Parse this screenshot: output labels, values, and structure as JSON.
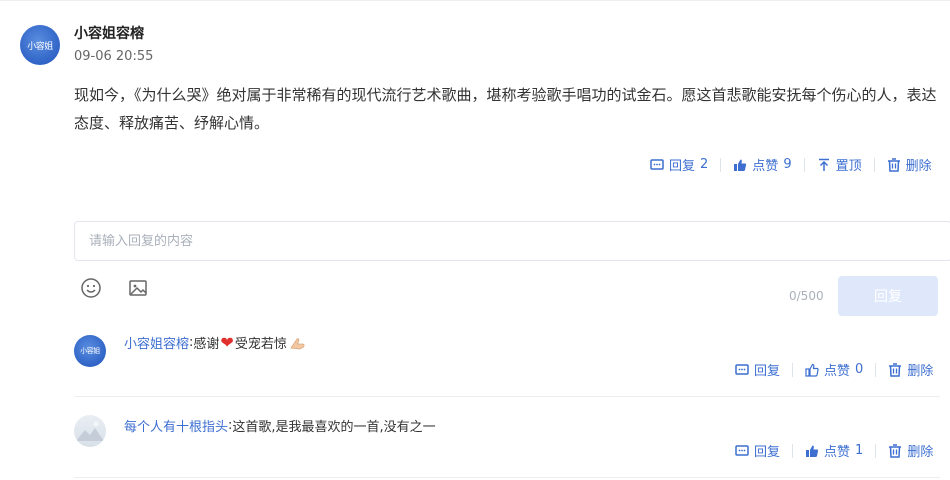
{
  "main_comment": {
    "avatar_text": "小容姐",
    "author": "小容姐容榕",
    "date": "09-06 20:55",
    "content": "现如今，《为什么哭》绝对属于非常稀有的现代流行艺术歌曲，堪称考验歌手唱功的试金石。愿这首悲歌能安抚每个伤心的人，表达态度、释放痛苦、纾解心情。",
    "actions": {
      "reply_label": "回复",
      "reply_count": "2",
      "like_label": "点赞",
      "like_count": "9",
      "pin_label": "置顶",
      "delete_label": "删除"
    }
  },
  "reply_box": {
    "placeholder": "请输入回复的内容",
    "counter": "0/500",
    "submit_label": "回复"
  },
  "replies": [
    {
      "avatar_text": "小容姐",
      "author": "小容姐容榕",
      "colon": ":",
      "text_before": "感谢",
      "emoji_heart": "❤",
      "text_after": "受宠若惊",
      "actions": {
        "reply_label": "回复",
        "like_label": "点赞",
        "like_count": "0",
        "delete_label": "删除"
      }
    },
    {
      "author": "每个人有十根指头",
      "colon": ":",
      "text": "这首歌,是我最喜欢的一首,没有之一",
      "actions": {
        "reply_label": "回复",
        "like_label": "点赞",
        "like_count": "1",
        "delete_label": "删除"
      }
    }
  ],
  "colors": {
    "accent": "#3d6fd1",
    "button_disabled": "#dfe8fb",
    "divider": "#eceef2"
  },
  "icons": [
    "comment-icon",
    "thumbs-up-icon",
    "pin-top-icon",
    "trash-icon",
    "emoji-icon",
    "image-icon"
  ]
}
